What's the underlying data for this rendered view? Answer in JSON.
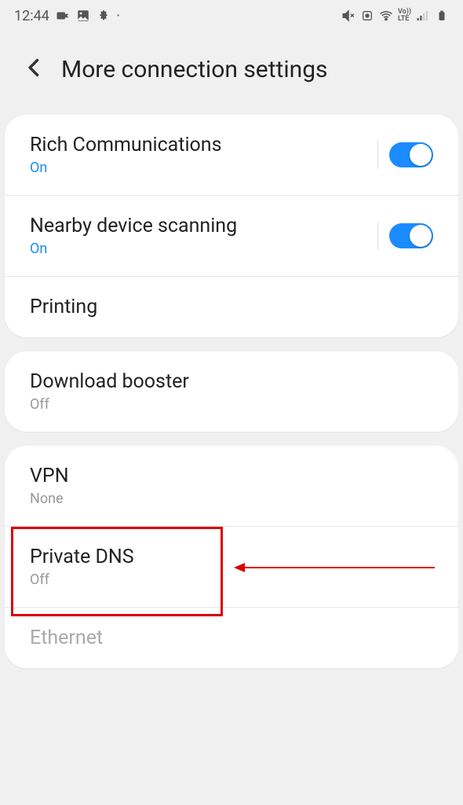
{
  "status_bar": {
    "time": "12:44"
  },
  "header": {
    "title": "More connection settings"
  },
  "group1": {
    "rich_comm": {
      "title": "Rich Communications",
      "status": "On"
    },
    "nearby": {
      "title": "Nearby device scanning",
      "status": "On"
    },
    "printing": {
      "title": "Printing"
    }
  },
  "group2": {
    "download_booster": {
      "title": "Download booster",
      "status": "Off"
    }
  },
  "group3": {
    "vpn": {
      "title": "VPN",
      "status": "None"
    },
    "private_dns": {
      "title": "Private DNS",
      "status": "Off"
    },
    "ethernet": {
      "title": "Ethernet"
    }
  }
}
